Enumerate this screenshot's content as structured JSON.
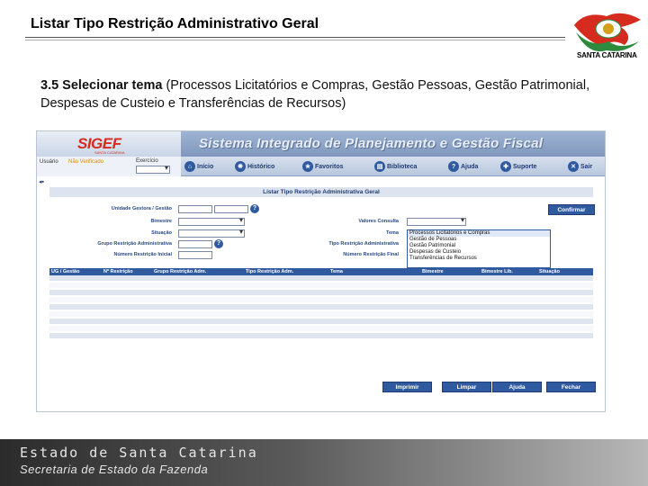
{
  "slide": {
    "title": "Listar Tipo Restrição Administrativo Geral",
    "logo_text": "SANTA CATARINA",
    "step_bold": "3.5 Selecionar tema",
    "step_rest": " (Processos Licitatórios e Compras, Gestão Pessoas, Gestão Patrimonial, Despesas de Custeio e Transferências de Recursos)"
  },
  "app": {
    "logo": "SIGEF",
    "logo_sub": "SANTA CATARINA",
    "banner": "Sistema Integrado de Planejamento e Gestão Fiscal",
    "user_label": "Usuário",
    "user_value": "Não Verificado",
    "exercicio_label": "Exercício",
    "menu": [
      {
        "label": "Início",
        "icon": "home-icon"
      },
      {
        "label": "Histórico",
        "icon": "history-icon"
      },
      {
        "label": "Favoritos",
        "icon": "star-icon"
      },
      {
        "label": "Biblioteca",
        "icon": "book-icon"
      },
      {
        "label": "Ajuda",
        "icon": "help-icon"
      },
      {
        "label": "Suporte",
        "icon": "support-icon"
      },
      {
        "label": "Sair",
        "icon": "exit-icon"
      }
    ],
    "form_title": "Listar Tipo Restrição Administrativa Geral",
    "fields": {
      "unidade": "Unidade Gestora / Gestão",
      "bimestre": "Bimestre",
      "situacao": "Situação",
      "grupo": "Grupo Restrição Administrativa",
      "numero_inicial": "Número Restrição Inicial",
      "valores": "Valores Consulta",
      "tema": "Tema",
      "tipo": "Tipo Restrição Administrativa",
      "numero_final": "Número Restrição Final"
    },
    "confirm_button": "Confirmar",
    "tema_options": [
      "Processos Licitatórios e Compras",
      "Gestão de Pessoas",
      "Gestão Patrimonial",
      "Despesas de Custeio",
      "Transferências de Recursos"
    ],
    "grid_columns": [
      "UG / Gestão",
      "Nº Restrição",
      "Grupo Restrição Adm.",
      "Tipo Restrição Adm.",
      "Tema",
      "Bimestre",
      "Bimestre Lib.",
      "Situação"
    ],
    "buttons": {
      "imprimir": "Imprimir",
      "limpar": "Limpar",
      "ajuda": "Ajuda",
      "fechar": "Fechar"
    }
  },
  "footer": {
    "line1": "Estado de Santa Catarina",
    "line2": "Secretaria de Estado da Fazenda"
  }
}
